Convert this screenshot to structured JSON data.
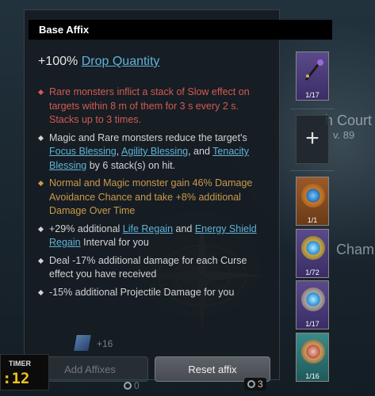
{
  "background": {
    "court_text": "h Court",
    "level_text": "v. 89",
    "chamber_text": "Chamb"
  },
  "panel": {
    "header": "Base Affix",
    "main_stat_prefix": "+100% ",
    "main_stat_link": "Drop Quantity",
    "affixes": [
      {
        "color": "red",
        "text": "Rare monsters inflict a stack of Slow effect on targets within 8 m of them for 3 s every 2 s. Stacks up to 3 times."
      },
      {
        "color": "white",
        "parts": [
          "Magic and Rare monsters reduce the target's ",
          "Focus Blessing",
          ", ",
          "Agility Blessing",
          ", and ",
          "Tenacity Blessing",
          " by 6 stack(s) on hit."
        ]
      },
      {
        "color": "gold",
        "text": "Normal and Magic monster gain 46% Damage Avoidance Chance and take +8% additional Damage Over Time"
      },
      {
        "color": "white",
        "parts": [
          "+29% additional ",
          "Life Regain",
          " and ",
          "Energy Shield Regain",
          " Interval for you"
        ]
      },
      {
        "color": "white",
        "text": "Deal -17% additional damage for each Curse effect you have received"
      },
      {
        "color": "white",
        "text": "-15% additional Projectile Damage for you"
      }
    ],
    "add_affix_count": "+16",
    "add_affixes_label": "Add Affixes",
    "reset_affix_label": "Reset affix",
    "add_cost": "0",
    "reset_cost": "3"
  },
  "timer": {
    "label": "TIMER",
    "value": ":12"
  },
  "side_slots": [
    {
      "count": "1/17",
      "icon": "staff-icon",
      "bg": "#4a3d7a"
    },
    {
      "count": "",
      "icon": "plus-icon"
    },
    {
      "count": "1/1",
      "icon": "compass-orange-icon",
      "bg": "#8a4a22"
    },
    {
      "count": "1/72",
      "icon": "compass-blue-icon",
      "bg": "#4a3d7a"
    },
    {
      "count": "1/17",
      "icon": "compass-blue-icon",
      "bg": "#4a3d7a"
    },
    {
      "count": "1/16",
      "icon": "compass-red-icon",
      "bg": "#2a6a6a"
    }
  ]
}
